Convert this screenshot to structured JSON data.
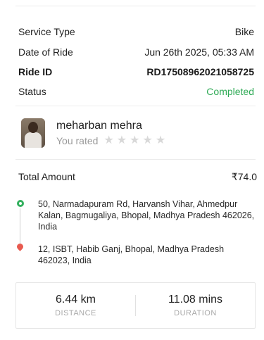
{
  "details": {
    "service_type_label": "Service Type",
    "service_type_value": "Bike",
    "date_label": "Date of Ride",
    "date_value": "Jun 26th 2025, 05:33 AM",
    "ride_id_label": "Ride ID",
    "ride_id_value": "RD17508962021058725",
    "status_label": "Status",
    "status_value": "Completed",
    "status_color": "#2eaa55"
  },
  "rider": {
    "name": "meharban mehra",
    "rated_label": "You rated",
    "stars": [
      "★",
      "★",
      "★",
      "★",
      "★"
    ],
    "rating_value": 0
  },
  "total": {
    "label": "Total Amount",
    "value": "₹74.0"
  },
  "route": {
    "pickup": "50, Narmadapuram Rd, Harvansh Vihar, Ahmedpur Kalan, Bagmugaliya, Bhopal, Madhya Pradesh 462026, India",
    "drop": "12, ISBT, Habib Ganj, Bhopal, Madhya Pradesh 462023, India",
    "pickup_color": "#33b05e",
    "drop_color": "#e85a4f"
  },
  "summary": {
    "distance_value": "6.44 km",
    "distance_label": "DISTANCE",
    "duration_value": "11.08 mins",
    "duration_label": "DURATION"
  }
}
